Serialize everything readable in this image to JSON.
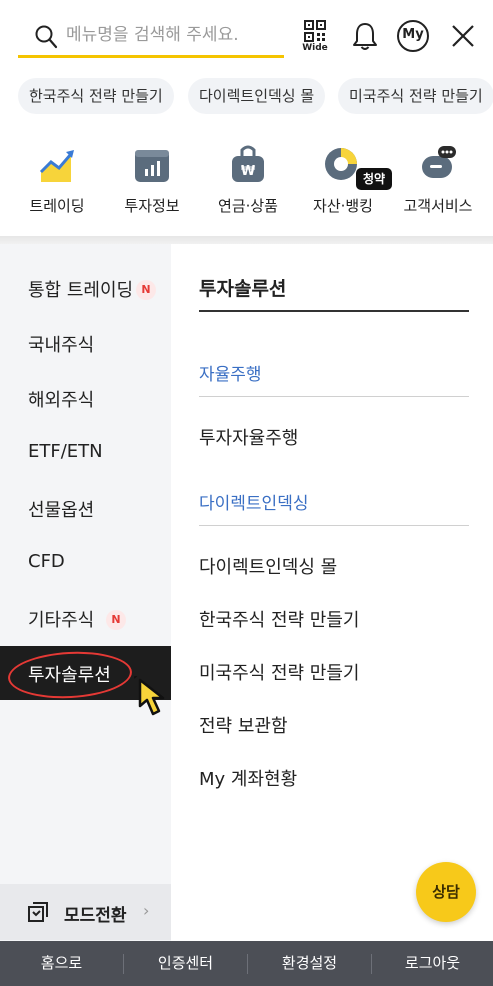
{
  "search": {
    "placeholder": "메뉴명을 검색해 주세요."
  },
  "header": {
    "qr_label": "Wide",
    "my_label": "My"
  },
  "chips": [
    "한국주식 전략 만들기",
    "다이렉트인덱싱 몰",
    "미국주식 전략 만들기"
  ],
  "quick_menu": [
    {
      "label": "트레이딩",
      "icon": "chart-up-icon"
    },
    {
      "label": "투자정보",
      "icon": "bar-chart-icon"
    },
    {
      "label": "연금·상품",
      "icon": "won-bag-icon"
    },
    {
      "label": "자산·뱅킹",
      "icon": "pie-chart-icon"
    },
    {
      "label": "고객서비스",
      "icon": "chat-bubble-icon"
    }
  ],
  "quick_badge": "청약",
  "left_menu": [
    {
      "label": "통합 트레이딩",
      "new": "N"
    },
    {
      "label": "국내주식"
    },
    {
      "label": "해외주식"
    },
    {
      "label": "ETF/ETN"
    },
    {
      "label": "선물옵션"
    },
    {
      "label": "CFD"
    },
    {
      "label": "기타주식",
      "new": "N"
    },
    {
      "label": "투자솔루션"
    }
  ],
  "mode_switch": {
    "label": "모드전환",
    "chevron": "›"
  },
  "right_panel": {
    "title": "투자솔루션",
    "groups": [
      {
        "heading": "자율주행",
        "items": [
          "투자자율주행"
        ]
      },
      {
        "heading": "다이렉트인덱싱",
        "items": [
          "다이렉트인덱싱 몰",
          "한국주식 전략 만들기",
          "미국주식 전략 만들기",
          "전략 보관함",
          "My 계좌현황"
        ]
      }
    ]
  },
  "consult_button": "상담",
  "footer": [
    "홈으로",
    "인증센터",
    "환경설정",
    "로그아웃"
  ],
  "colors": {
    "accent": "#f5c400",
    "link_blue": "#3a6fc4",
    "new_red": "#e53935",
    "footer_bg": "#4c4f56"
  }
}
